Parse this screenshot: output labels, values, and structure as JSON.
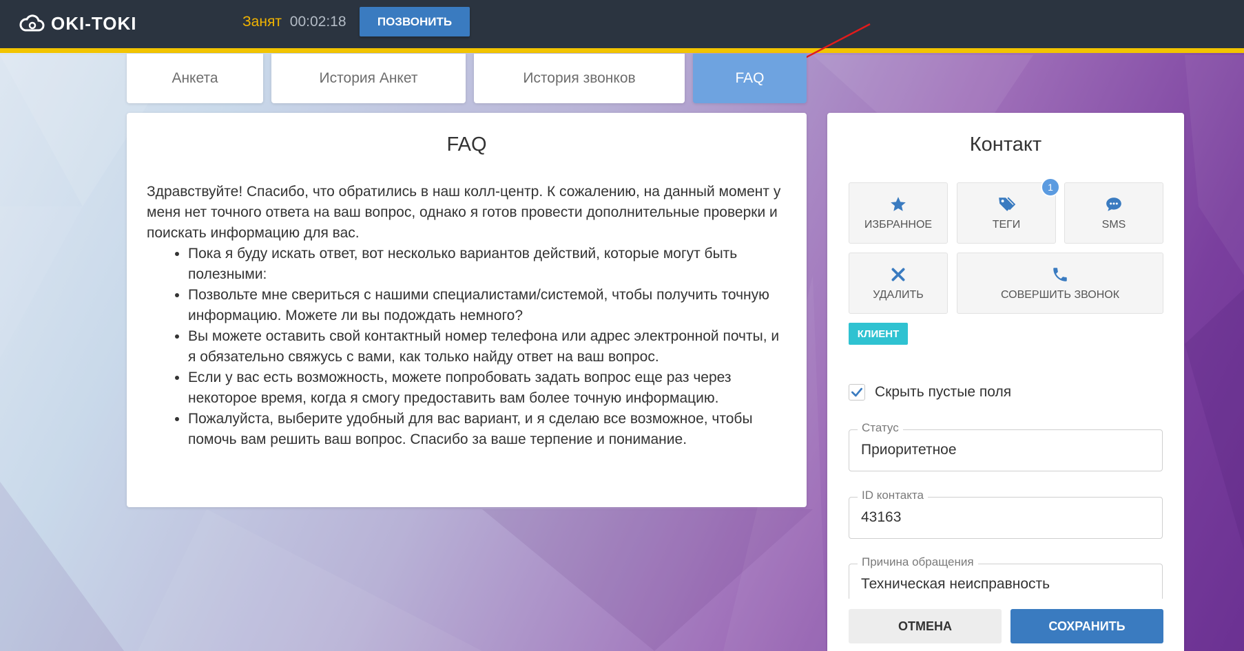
{
  "header": {
    "logo_text": "OKI-TOKI",
    "status_label": "Занят",
    "status_time": "00:02:18",
    "call_button": "ПОЗВОНИТЬ"
  },
  "tabs": [
    {
      "label": "Анкета",
      "active": false
    },
    {
      "label": "История Анкет",
      "active": false
    },
    {
      "label": "История звонков",
      "active": false
    },
    {
      "label": "FAQ",
      "active": true
    }
  ],
  "faq": {
    "title": "FAQ",
    "intro": "Здравствуйте! Спасибо, что обратились в наш колл-центр. К сожалению, на данный момент у меня нет точного ответа на ваш вопрос, однако я готов провести дополнительные проверки и поискать информацию для вас.",
    "items": [
      "Пока я буду искать ответ, вот несколько вариантов действий, которые могут быть полезными:",
      "Позвольте мне свериться с нашими специалистами/системой, чтобы получить точную информацию. Можете ли вы подождать немного?",
      "Вы можете оставить свой контактный номер телефона или адрес электронной почты, и я обязательно свяжусь с вами, как только найду ответ на ваш вопрос.",
      "Если у вас есть возможность, можете попробовать задать вопрос еще раз через некоторое время, когда я смогу предоставить вам более точную информацию.",
      "Пожалуйста, выберите удобный для вас вариант, и я сделаю все возможное, чтобы помочь вам решить ваш вопрос. Спасибо за ваше терпение и понимание."
    ]
  },
  "contact": {
    "title": "Контакт",
    "actions": {
      "favorite": "ИЗБРАННОЕ",
      "tags": "ТЕГИ",
      "tags_badge": "1",
      "sms": "SMS",
      "delete": "УДАЛИТЬ",
      "make_call": "СОВЕРШИТЬ ЗВОНОК"
    },
    "client_tag": "КЛИЕНТ",
    "hide_empty_label": "Скрыть пустые поля",
    "hide_empty_checked": true,
    "fields": [
      {
        "label": "Статус",
        "value": "Приоритетное"
      },
      {
        "label": "ID контакта",
        "value": "43163"
      },
      {
        "label": "Причина обращения",
        "value": "Техническая неисправность"
      }
    ],
    "cancel_button": "ОТМЕНА",
    "save_button": "СОХРАНИТЬ"
  },
  "colors": {
    "header_bg": "#2b3440",
    "accent_stripe": "#f2c400",
    "primary": "#3a7bc0",
    "active_tab": "#6ea3e0",
    "client_tag": "#2fc2d1"
  }
}
